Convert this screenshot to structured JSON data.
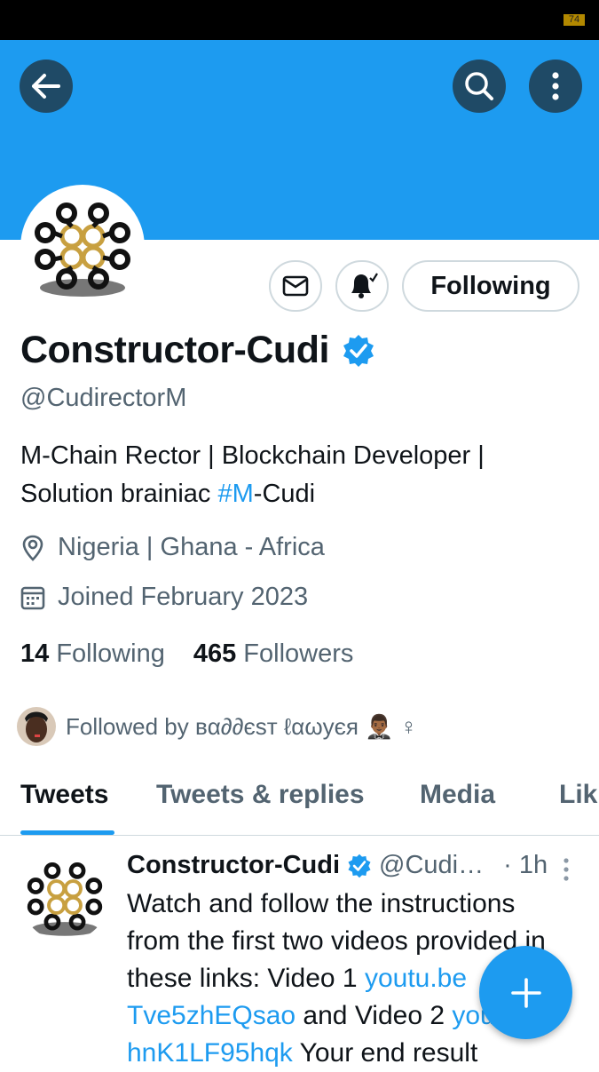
{
  "statusbar": {
    "battery_level": "74"
  },
  "header": {
    "back_icon": "arrow-left-icon",
    "search_icon": "search-icon",
    "more_icon": "more-vertical-icon",
    "banner_color": "#1d9bf0"
  },
  "profile": {
    "name": "Constructor-Cudi",
    "handle": "@CudirectorM",
    "bio_line1": "M-Chain Rector | Blockchain Developer |",
    "bio_line2_prefix": "Solution brainiac ",
    "bio_hashtag": "#M",
    "bio_line2_suffix": "-Cudi",
    "location": "Nigeria | Ghana - Africa",
    "joined": "Joined February 2023",
    "following_count": "14",
    "following_label": "Following",
    "followers_count": "465",
    "followers_label": "Followers",
    "followed_by": "Followed by вα∂∂єѕт ℓαωуєя 🤵🏾‍♂️ ♀"
  },
  "actions": {
    "message_icon": "envelope-icon",
    "notify_icon": "bell-check-icon",
    "following_button": "Following"
  },
  "tabs": [
    "Tweets",
    "Tweets & replies",
    "Media",
    "Lik"
  ],
  "tweet": {
    "name": "Constructor-Cudi",
    "handle": "@Cudi…",
    "time": "· 1h",
    "line1": "Watch and follow the instructions",
    "line2": "from the first two videos provided in",
    "line3_prefix": "these links: Video 1 ",
    "link1": "youtu.be",
    "link1_cont": "Tve5zhEQsao",
    "line4_mid": " and Video 2 ",
    "link2": "youtu.be/",
    "link2_cont": "hnK1LF95hqk",
    "line5_suffix": " Your end result"
  },
  "fab": {
    "icon": "plus-icon"
  },
  "colors": {
    "accent": "#1d9bf0",
    "dark_button": "#1f4a66",
    "text": "#0f1419",
    "secondary": "#536471"
  }
}
